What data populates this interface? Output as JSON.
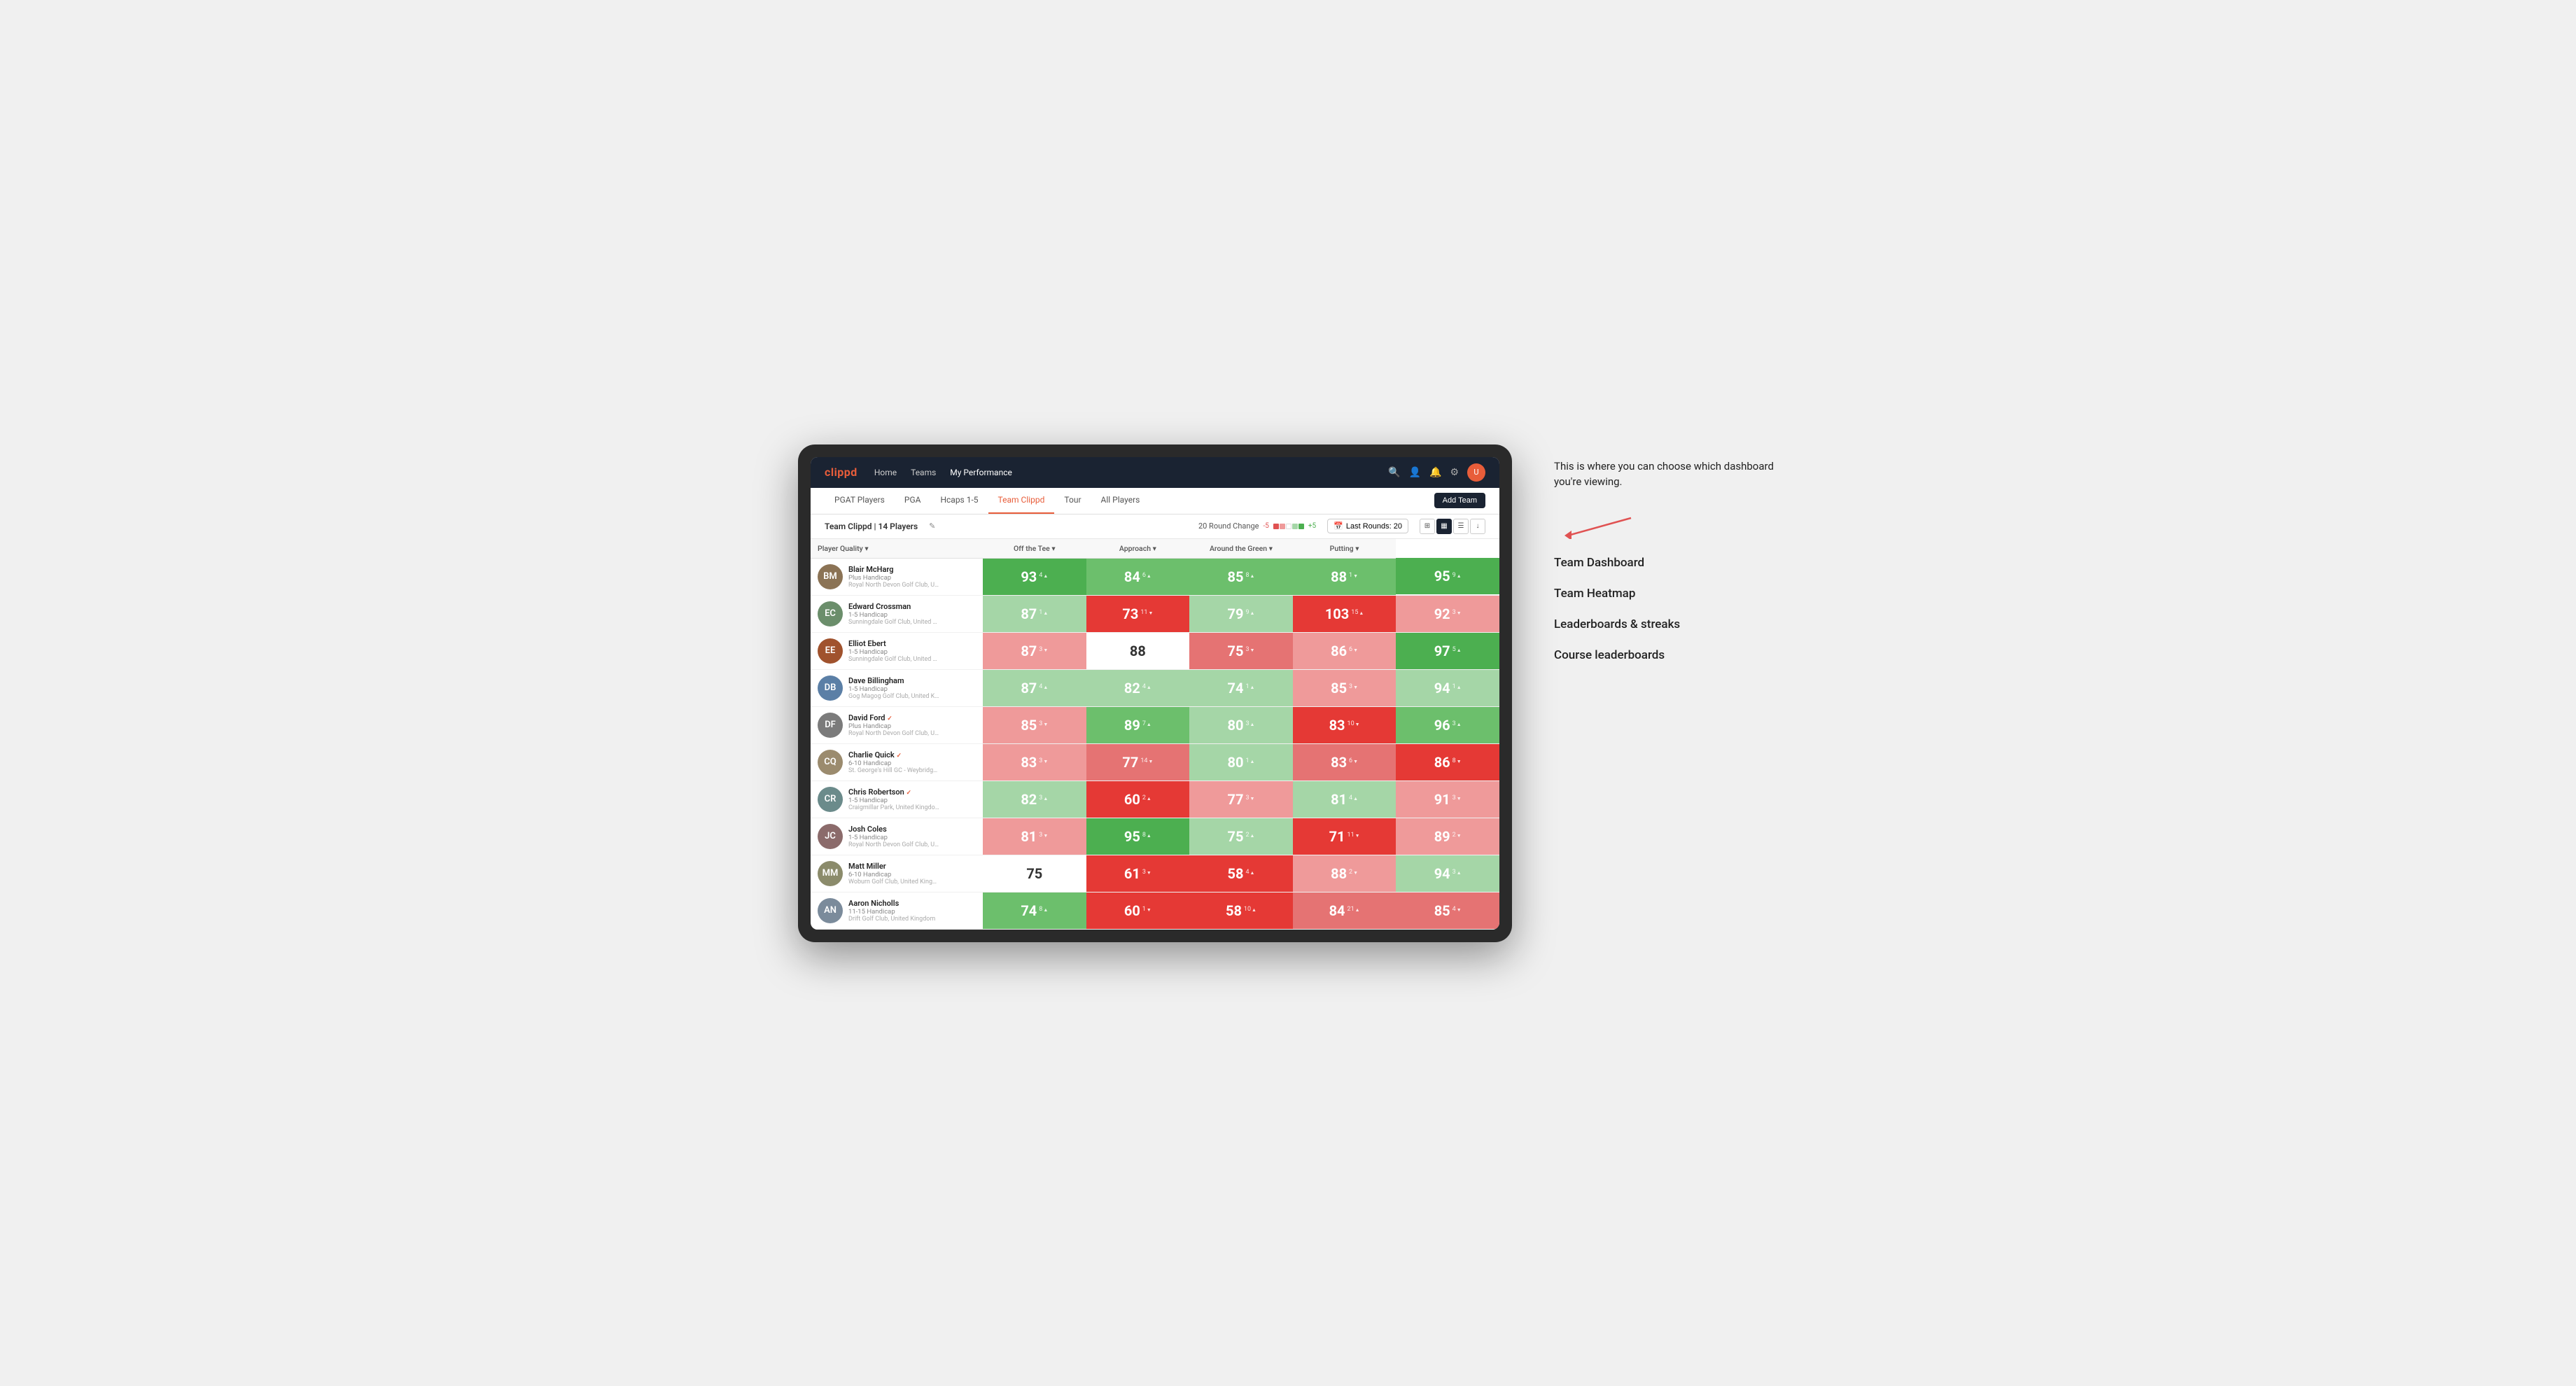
{
  "annotation": {
    "intro_text": "This is where you can choose which dashboard you're viewing.",
    "items": [
      "Team Dashboard",
      "Team Heatmap",
      "Leaderboards & streaks",
      "Course leaderboards"
    ]
  },
  "navbar": {
    "logo": "clippd",
    "links": [
      "Home",
      "Teams",
      "My Performance"
    ],
    "active_link": "My Performance"
  },
  "subnav": {
    "tabs": [
      "PGAT Players",
      "PGA",
      "Hcaps 1-5",
      "Team Clippd",
      "Tour",
      "All Players"
    ],
    "active_tab": "Team Clippd",
    "add_team_label": "Add Team"
  },
  "team_bar": {
    "team_name": "Team Clippd",
    "player_count": "14 Players",
    "round_change_label": "20 Round Change",
    "round_change_neg": "-5",
    "round_change_pos": "+5",
    "last_rounds_label": "Last Rounds: 20"
  },
  "table": {
    "columns": [
      "Player Quality ▾",
      "Off the Tee ▾",
      "Approach ▾",
      "Around the Green ▾",
      "Putting ▾"
    ],
    "rows": [
      {
        "name": "Blair McHarg",
        "handicap": "Plus Handicap",
        "club": "Royal North Devon Golf Club, United Kingdom",
        "avatar_color": "#8B7355",
        "initials": "BM",
        "scores": [
          {
            "val": 93,
            "change": "4▲",
            "bg": "bg-green-dark"
          },
          {
            "val": 84,
            "change": "6▲",
            "bg": "bg-green-med"
          },
          {
            "val": 85,
            "change": "8▲",
            "bg": "bg-green-med"
          },
          {
            "val": 88,
            "change": "1▼",
            "bg": "bg-green-med"
          },
          {
            "val": 95,
            "change": "9▲",
            "bg": "bg-green-dark"
          }
        ]
      },
      {
        "name": "Edward Crossman",
        "handicap": "1-5 Handicap",
        "club": "Sunningdale Golf Club, United Kingdom",
        "avatar_color": "#6B8E6B",
        "initials": "EC",
        "scores": [
          {
            "val": 87,
            "change": "1▲",
            "bg": "bg-green-light"
          },
          {
            "val": 73,
            "change": "11▼",
            "bg": "bg-red-dark"
          },
          {
            "val": 79,
            "change": "9▲",
            "bg": "bg-green-light"
          },
          {
            "val": 103,
            "change": "15▲",
            "bg": "bg-red-dark"
          },
          {
            "val": 92,
            "change": "3▼",
            "bg": "bg-red-light"
          }
        ]
      },
      {
        "name": "Elliot Ebert",
        "handicap": "1-5 Handicap",
        "club": "Sunningdale Golf Club, United Kingdom",
        "avatar_color": "#A0522D",
        "initials": "EE",
        "scores": [
          {
            "val": 87,
            "change": "3▼",
            "bg": "bg-red-light"
          },
          {
            "val": 88,
            "change": "",
            "bg": "bg-white"
          },
          {
            "val": 75,
            "change": "3▼",
            "bg": "bg-red-med"
          },
          {
            "val": 86,
            "change": "6▼",
            "bg": "bg-red-light"
          },
          {
            "val": 97,
            "change": "5▲",
            "bg": "bg-green-dark"
          }
        ]
      },
      {
        "name": "Dave Billingham",
        "handicap": "1-5 Handicap",
        "club": "Gog Magog Golf Club, United Kingdom",
        "avatar_color": "#5B7FA6",
        "initials": "DB",
        "scores": [
          {
            "val": 87,
            "change": "4▲",
            "bg": "bg-green-light"
          },
          {
            "val": 82,
            "change": "4▲",
            "bg": "bg-green-light"
          },
          {
            "val": 74,
            "change": "1▲",
            "bg": "bg-green-light"
          },
          {
            "val": 85,
            "change": "3▼",
            "bg": "bg-red-light"
          },
          {
            "val": 94,
            "change": "1▲",
            "bg": "bg-green-light"
          }
        ]
      },
      {
        "name": "David Ford",
        "handicap": "Plus Handicap",
        "club": "Royal North Devon Golf Club, United Kingdom",
        "avatar_color": "#7B7B7B",
        "initials": "DF",
        "verified": true,
        "scores": [
          {
            "val": 85,
            "change": "3▼",
            "bg": "bg-red-light"
          },
          {
            "val": 89,
            "change": "7▲",
            "bg": "bg-green-med"
          },
          {
            "val": 80,
            "change": "3▲",
            "bg": "bg-green-light"
          },
          {
            "val": 83,
            "change": "10▼",
            "bg": "bg-red-dark"
          },
          {
            "val": 96,
            "change": "3▲",
            "bg": "bg-green-med"
          }
        ]
      },
      {
        "name": "Charlie Quick",
        "handicap": "6-10 Handicap",
        "club": "St. George's Hill GC - Weybridge · Surrey, Uni...",
        "avatar_color": "#9B8B6E",
        "initials": "CQ",
        "verified": true,
        "scores": [
          {
            "val": 83,
            "change": "3▼",
            "bg": "bg-red-light"
          },
          {
            "val": 77,
            "change": "14▼",
            "bg": "bg-red-med"
          },
          {
            "val": 80,
            "change": "1▲",
            "bg": "bg-green-light"
          },
          {
            "val": 83,
            "change": "6▼",
            "bg": "bg-red-med"
          },
          {
            "val": 86,
            "change": "8▼",
            "bg": "bg-red-dark"
          }
        ]
      },
      {
        "name": "Chris Robertson",
        "handicap": "1-5 Handicap",
        "club": "Craigmillar Park, United Kingdom",
        "avatar_color": "#6B8B8B",
        "initials": "CR",
        "verified": true,
        "scores": [
          {
            "val": 82,
            "change": "3▲",
            "bg": "bg-green-light"
          },
          {
            "val": 60,
            "change": "2▲",
            "bg": "bg-red-dark"
          },
          {
            "val": 77,
            "change": "3▼",
            "bg": "bg-red-light"
          },
          {
            "val": 81,
            "change": "4▲",
            "bg": "bg-green-light"
          },
          {
            "val": 91,
            "change": "3▼",
            "bg": "bg-red-light"
          }
        ]
      },
      {
        "name": "Josh Coles",
        "handicap": "1-5 Handicap",
        "club": "Royal North Devon Golf Club, United Kingdom",
        "avatar_color": "#8B6B6B",
        "initials": "JC",
        "scores": [
          {
            "val": 81,
            "change": "3▼",
            "bg": "bg-red-light"
          },
          {
            "val": 95,
            "change": "8▲",
            "bg": "bg-green-dark"
          },
          {
            "val": 75,
            "change": "2▲",
            "bg": "bg-green-light"
          },
          {
            "val": 71,
            "change": "11▼",
            "bg": "bg-red-dark"
          },
          {
            "val": 89,
            "change": "2▼",
            "bg": "bg-red-light"
          }
        ]
      },
      {
        "name": "Matt Miller",
        "handicap": "6-10 Handicap",
        "club": "Woburn Golf Club, United Kingdom",
        "avatar_color": "#8B8B6B",
        "initials": "MM",
        "scores": [
          {
            "val": 75,
            "change": "",
            "bg": "bg-white"
          },
          {
            "val": 61,
            "change": "3▼",
            "bg": "bg-red-dark"
          },
          {
            "val": 58,
            "change": "4▲",
            "bg": "bg-red-dark"
          },
          {
            "val": 88,
            "change": "2▼",
            "bg": "bg-red-light"
          },
          {
            "val": 94,
            "change": "3▲",
            "bg": "bg-green-light"
          }
        ]
      },
      {
        "name": "Aaron Nicholls",
        "handicap": "11-15 Handicap",
        "club": "Drift Golf Club, United Kingdom",
        "avatar_color": "#7B8B9B",
        "initials": "AN",
        "scores": [
          {
            "val": 74,
            "change": "8▲",
            "bg": "bg-green-med"
          },
          {
            "val": 60,
            "change": "1▼",
            "bg": "bg-red-dark"
          },
          {
            "val": 58,
            "change": "10▲",
            "bg": "bg-red-dark"
          },
          {
            "val": 84,
            "change": "21▲",
            "bg": "bg-red-med"
          },
          {
            "val": 85,
            "change": "4▼",
            "bg": "bg-red-med"
          }
        ]
      }
    ]
  }
}
